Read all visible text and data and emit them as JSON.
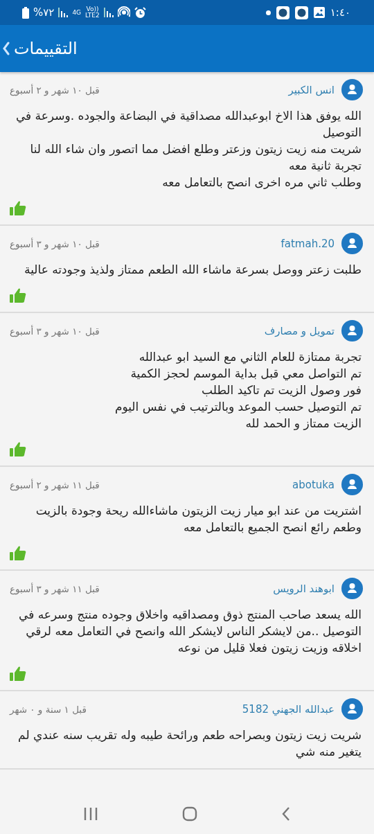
{
  "status_bar": {
    "battery": "%٧٢",
    "network": "4G",
    "volte": "Vo))",
    "lte": "LTE2",
    "time": "١:٤٠"
  },
  "app_bar": {
    "title": "التقييمات"
  },
  "reviews": [
    {
      "name": "انس الكبير",
      "date": "قبل ١٠ شهر و ٢ أسبوع",
      "lines": [
        "الله يوفق هذا الاخ ابوعبدالله مصداقية في البضاعة والجوده .وسرعة في التوصيل",
        "شريت منه زيت زيتون وزعتر وطلع افضل مما اتصور وان شاء الله لنا تجربة ثانية معه",
        "وطلب ثاني مره اخرى انصح بالتعامل معه"
      ],
      "liked": true
    },
    {
      "name": "fatmah.20",
      "date": "قبل ١٠ شهر و ٣ أسبوع",
      "lines": [
        "طلبت زعتر ووصل بسرعة ماشاء الله الطعم ممتاز ولذيذ وجودته عالية"
      ],
      "liked": true
    },
    {
      "name": "تمويل و مصارف",
      "date": "قبل ١٠ شهر و ٣ أسبوع",
      "lines": [
        "تجربة ممتازة للعام الثاني مع السيد ابو عبدالله",
        "تم التواصل معي قبل بداية الموسم لحجز الكمية",
        "فور وصول الزيت تم تاكيد الطلب",
        "تم التوصيل حسب الموعد وبالترتيب في نفس اليوم",
        "الزيت ممتاز و الحمد لله"
      ],
      "liked": true
    },
    {
      "name": "abotuka",
      "date": "قبل ١١ شهر و ٢ أسبوع",
      "lines": [
        "اشتريت من عند ابو ميار زيت الزيتون ماشاءالله ريحة وجودة بالزيت وطعم رائع انصح الجميع بالتعامل معه"
      ],
      "liked": true
    },
    {
      "name": "ابوهند الرويس",
      "date": "قبل ١١ شهر و ٣ أسبوع",
      "lines": [
        "الله يسعد صاحب المنتج ذوق ومصداقيه واخلاق وجوده منتج وسرعه في التوصيل ..من لايشكر الناس لايشكر الله وانصح في التعامل معه لرقي اخلاقه وزيت زيتون فعلا قليل من نوعه"
      ],
      "liked": true
    },
    {
      "name": "عبدالله الجهني 5182",
      "date": "قبل ١ سنة و ٠ شهر",
      "lines": [
        "شريت زيت زيتون وبصراحه طعم ورائحة طيبه وله تقريب سنه عندي لم يتغير منه شي"
      ],
      "liked": false
    }
  ]
}
